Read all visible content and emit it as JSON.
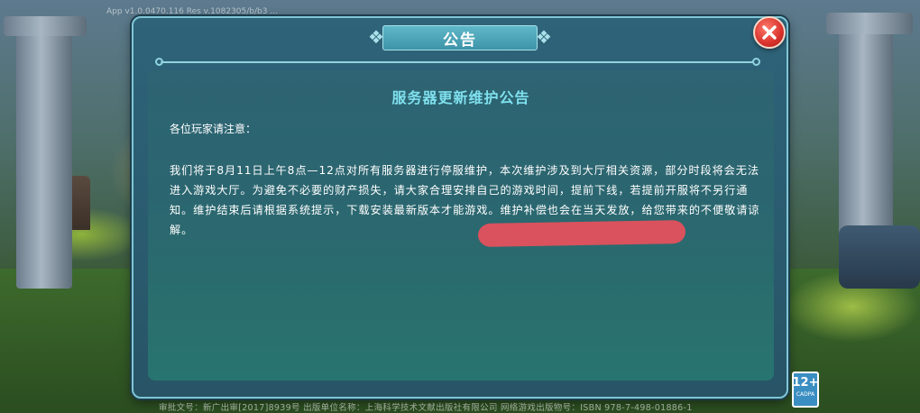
{
  "app": {
    "version_text": "App v1.0.0470.116  Res v.1082305/b/b3 ..."
  },
  "dialog": {
    "title": "公告",
    "close_icon": "close-icon",
    "notice_title": "服务器更新维护公告",
    "greeting": "各位玩家请注意：",
    "body": "我们将于8月11日上午8点—12点对所有服务器进行停服维护，本次维护涉及到大厅相关资源，部分时段将会无法进入游戏大厅。为避免不必要的财产损失，请大家合理安排自己的游戏时间，提前下线，若提前开服将不另行通知。维护结束后请根据系统提示，下载安装最新版本才能游戏。维护补偿也会在当天发放，给您带来的不便敬请谅解。"
  },
  "footer": {
    "approval_text": "审批文号：新广出审[2017]8939号  出版单位名称：上海科学技术文献出版社有限公司  网络游戏出版物号：ISBN 978-7-498-01886-1"
  },
  "age_rating": {
    "value": "12+",
    "caption": "CADPA"
  },
  "colors": {
    "accent": "#7fe0ee",
    "redaction": "#d9525d",
    "close": "#d8322c"
  }
}
